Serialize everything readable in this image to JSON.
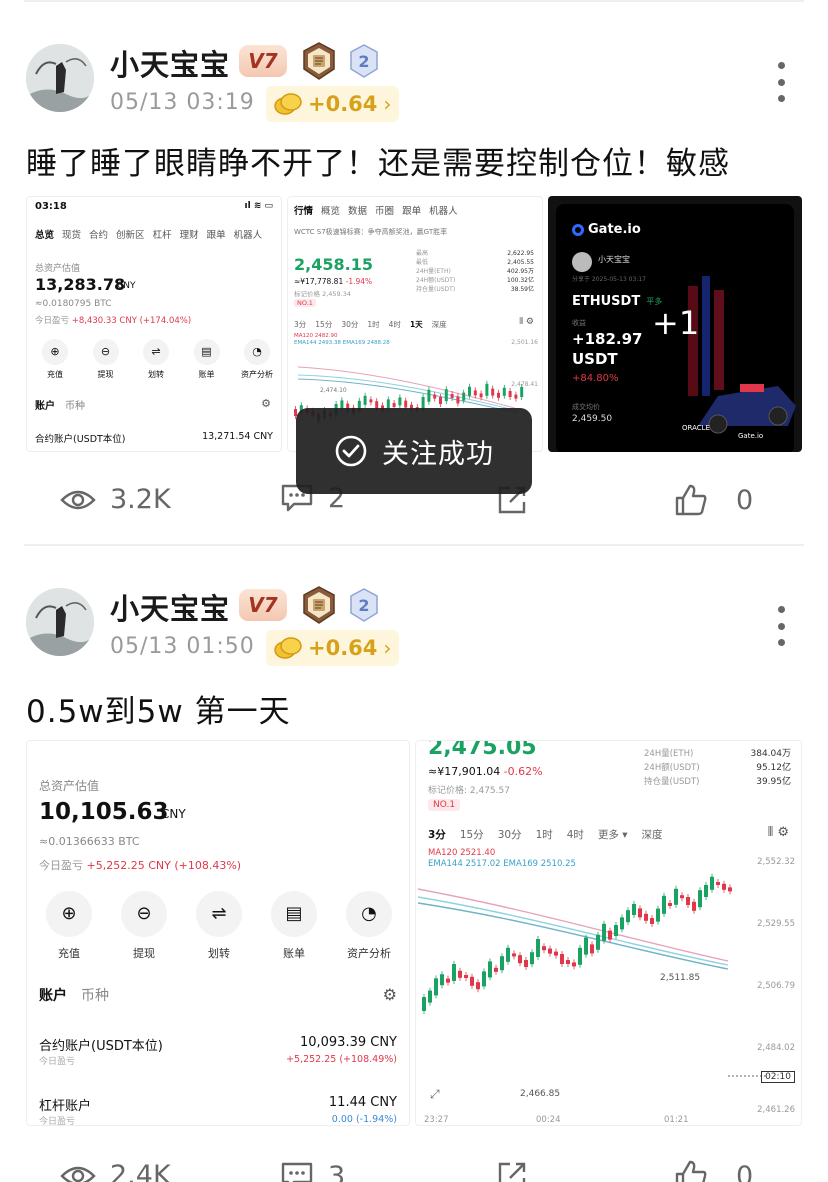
{
  "posts": [
    {
      "username": "小天宝宝",
      "level": "V7",
      "tier_badge": "2",
      "timestamp": "05/13 03:19",
      "coin_reward": "+0.64",
      "text": "睡了睡了眼睛睁不开了！还是需要控制仓位！敏感",
      "views": "3.2K",
      "comments": "2",
      "likes": "0",
      "images": {
        "asset_screen": {
          "status_time": "03:18",
          "tabs": [
            "总览",
            "现货",
            "合约",
            "创新区",
            "杠杆",
            "理财",
            "跟单",
            "机器人"
          ],
          "total_label": "总资产估值",
          "total_value": "13,283.78",
          "currency": "CNY",
          "btc_value": "≈0.0180795 BTC",
          "today_pnl_label": "今日盈亏",
          "today_pnl": "+8,430.33 CNY (+174.04%)",
          "quick_actions": [
            "充值",
            "提现",
            "划转",
            "账单",
            "资产分析"
          ],
          "account_tabs": [
            "账户",
            "币种"
          ],
          "contract_account_label": "合约账户(USDT本位)",
          "contract_account_value": "13,271.54 CNY"
        },
        "market_screen": {
          "tabs": [
            "行情",
            "概览",
            "数据",
            "币圈",
            "跟单",
            "机器人"
          ],
          "notice": "WCTC S7极速锦标赛：争夺高额奖池，赢GT胜率",
          "price": "2,458.15",
          "cny_price": "≈¥17,778.81",
          "change": "-1.94%",
          "mark_price": "标记价格 2,459.34",
          "rank_tag": "NO.1",
          "stats_labels": [
            "最高",
            "最低",
            "24H量(ETH)",
            "24H额(USDT)",
            "持仓量(USDT)"
          ],
          "stats_values": [
            "2,622.95",
            "2,405.55",
            "402.95万",
            "100.32亿",
            "38.59亿"
          ],
          "timeframes": [
            "3分",
            "15分",
            "30分",
            "1时",
            "4时",
            "1天",
            "深度"
          ],
          "ma_label": "MA120 2482.90",
          "ema_label": "EMA144 2493.38  EMA169 2488.28",
          "axis_ticks": [
            "2,501.16",
            "2,478.41",
            "2,455.41"
          ],
          "low_label": "2,474.10"
        },
        "share_card": {
          "brand": "Gate.io",
          "user": "小天宝宝",
          "date": "分享于 2025-05-13 03:17",
          "pair": "ETHUSDT",
          "side": "平多",
          "pnl_label": "收益",
          "pnl": "+182.97",
          "pnl_unit": "USDT",
          "pnl_pct": "+84.80%",
          "avg_price_label": "成交均价",
          "avg_price": "2,459.50",
          "more_count": "+1"
        }
      }
    },
    {
      "username": "小天宝宝",
      "level": "V7",
      "tier_badge": "2",
      "timestamp": "05/13 01:50",
      "coin_reward": "+0.64",
      "text": "0.5w到5w 第一天",
      "views": "2.4K",
      "comments": "3",
      "likes": "0",
      "images": {
        "asset_screen": {
          "total_label": "总资产估值",
          "total_value": "10,105.63",
          "currency": "CNY",
          "btc_value": "≈0.01366633  BTC",
          "today_pnl_label": "今日盈亏",
          "today_pnl": "+5,252.25 CNY (+108.43%)",
          "quick_actions": [
            "充值",
            "提现",
            "划转",
            "账单",
            "资产分析"
          ],
          "account_tabs": [
            "账户",
            "币种"
          ],
          "contract_account_label": "合约账户(USDT本位)",
          "contract_account_value": "10,093.39 CNY",
          "contract_account_sub": "今日盈亏",
          "contract_account_pnl": "+5,252.25 (+108.49%)",
          "margin_account_label": "杠杆账户",
          "margin_account_value": "11.44 CNY",
          "margin_account_sub": "今日盈亏",
          "margin_account_pnl": "0.00 (-1.94%)"
        },
        "market_screen": {
          "price": "2,475.05",
          "cny_price": "≈¥17,901.04",
          "change": "-0.62%",
          "mark_price": "标记价格: 2,475.57",
          "rank_tag": "NO.1",
          "stats_labels": [
            "24H量(ETH)",
            "24H额(USDT)",
            "持仓量(USDT)"
          ],
          "stats_values": [
            "384.04万",
            "95.12亿",
            "39.95亿"
          ],
          "timeframes": [
            "3分",
            "15分",
            "30分",
            "1时",
            "4时",
            "更多 ▾",
            "深度"
          ],
          "ma_label": "MA120 2521.40",
          "ema_label": "EMA144 2517.02  EMA169 2510.25",
          "axis_ticks": [
            "2,552.32",
            "2,529.55",
            "2,506.79",
            "2,484.02",
            "2,461.26"
          ],
          "high_label": "2,511.85",
          "low_label": "2,466.85",
          "current_tag": "02:10",
          "time_ticks": [
            "23:27",
            "00:24",
            "01:21"
          ]
        }
      }
    }
  ],
  "toast": {
    "text": "关注成功"
  },
  "colors": {
    "up": "#1aa262",
    "down": "#e0384a",
    "coin": "#d7a21a",
    "level_badge": "#a4331f"
  }
}
